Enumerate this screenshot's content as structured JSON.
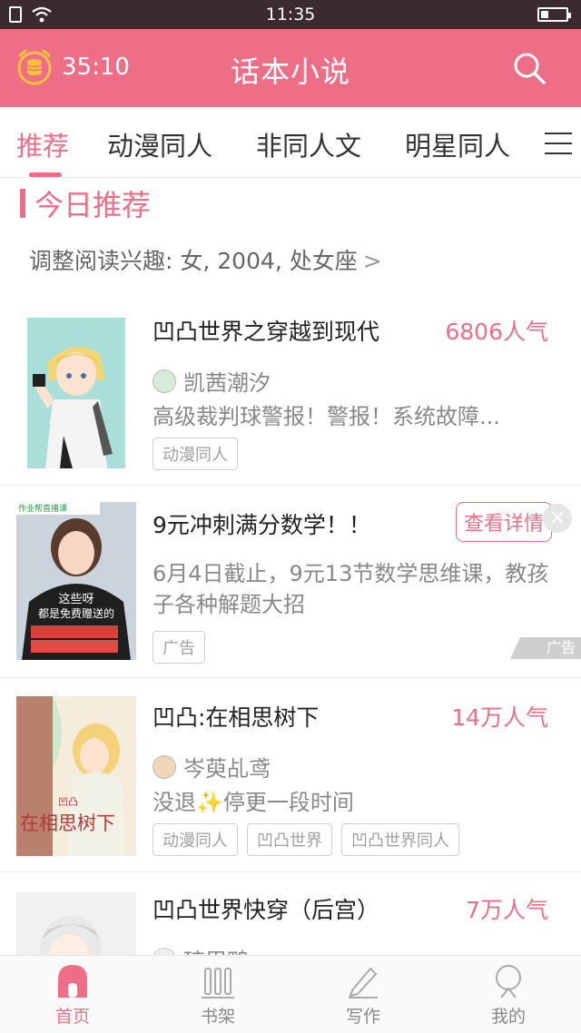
{
  "status_bar": {
    "time": "11:35"
  },
  "header": {
    "timer": "35:10",
    "title": "话本小说"
  },
  "tabs": [
    {
      "label": "推荐",
      "active": true
    },
    {
      "label": "动漫同人"
    },
    {
      "label": "非同人文"
    },
    {
      "label": "明星同人"
    }
  ],
  "section": {
    "title": "今日推荐",
    "interest": "调整阅读兴趣: 女, 2004, 处女座",
    "interest_chevron": ">"
  },
  "cards": [
    {
      "title": "凹凸世界之穿越到现代",
      "popularity": "6806人气",
      "author": "凯茜潮汐",
      "desc": "高级裁判球警报！警报！系统故障...",
      "tags": [
        "动漫同人"
      ]
    },
    {
      "title": "9元冲刺满分数学！！",
      "button": "查看详情",
      "desc": "6月4日截止，9元13节数学思维课，教孩子各种解题大招",
      "tags": [
        "广告"
      ],
      "corner": "广告",
      "cover_text_1": "这些呀",
      "cover_text_2": "都是免费赠送的",
      "cover_badge": "作业帮直播课"
    },
    {
      "title": "凹凸:在相思树下",
      "popularity": "14万人气",
      "author": "岑萸乩鸢",
      "desc": "没退✨停更一段时间",
      "tags": [
        "动漫同人",
        "凹凸世界",
        "凹凸世界同人"
      ],
      "cover_text": "在相思树下",
      "cover_sub": "凹凸"
    },
    {
      "title": "凹凸世界快穿（后宫）",
      "popularity": "7万人气",
      "author": "琼甩鸭"
    }
  ],
  "bottom_nav": [
    {
      "label": "首页",
      "active": true
    },
    {
      "label": "书架"
    },
    {
      "label": "写作"
    },
    {
      "label": "我的"
    }
  ],
  "colors": {
    "accent": "#ef6e87",
    "status_bar": "#3b2a2e"
  }
}
